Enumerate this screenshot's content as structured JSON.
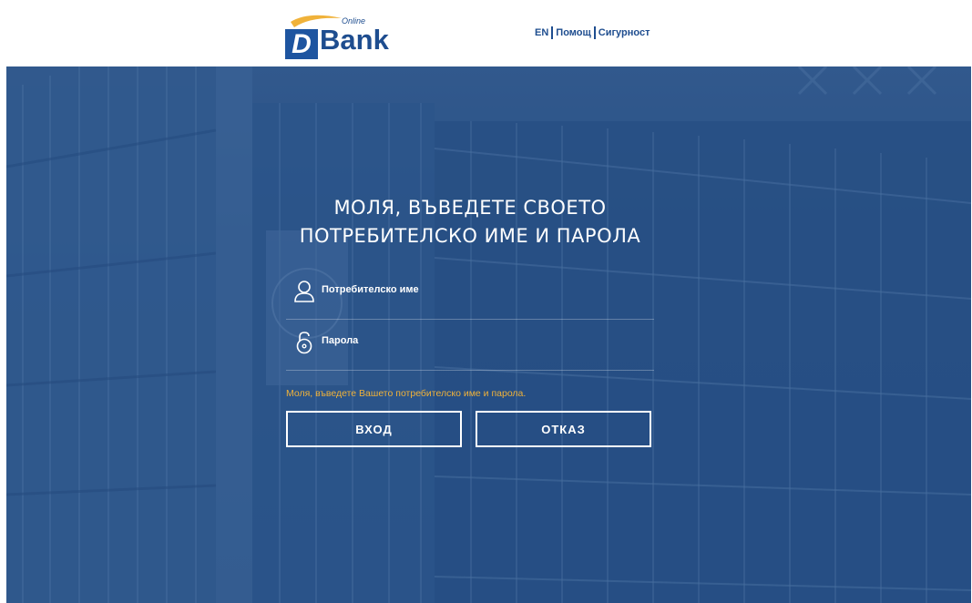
{
  "brand": {
    "letter": "D",
    "name": "Bank",
    "tagline": "Online",
    "colors": {
      "primary": "#1e4d8f",
      "accent": "#f0b23a"
    }
  },
  "top_nav": {
    "items": [
      {
        "label": "EN"
      },
      {
        "label": "Помощ"
      },
      {
        "label": "Сигурност"
      }
    ]
  },
  "login": {
    "title_line1": "МОЛЯ, ВЪВЕДЕТЕ СВОЕТО",
    "title_line2": "ПОТРЕБИТЕЛСКО ИМЕ И ПАРОЛА",
    "username": {
      "label": "Потребителско име",
      "icon": "user-icon",
      "value": ""
    },
    "password": {
      "label": "Парола",
      "icon": "unlock-icon",
      "value": ""
    },
    "error_message": "Моля, въведете Вашето потребителско име и парола.",
    "login_button": "ВХОД",
    "cancel_button": "ОТКАЗ"
  }
}
